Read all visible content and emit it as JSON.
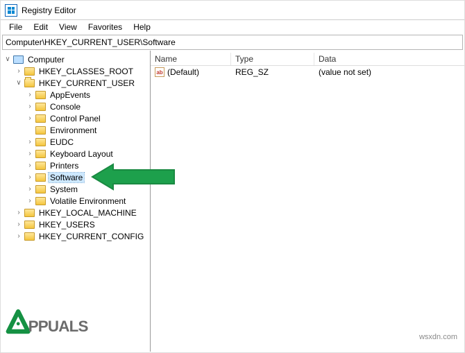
{
  "window": {
    "title": "Registry Editor"
  },
  "menu": {
    "file": "File",
    "edit": "Edit",
    "view": "View",
    "favorites": "Favorites",
    "help": "Help"
  },
  "address": "Computer\\HKEY_CURRENT_USER\\Software",
  "tree": {
    "root": "Computer",
    "hives": {
      "hkcr": "HKEY_CLASSES_ROOT",
      "hkcu": "HKEY_CURRENT_USER",
      "hklm": "HKEY_LOCAL_MACHINE",
      "hku": "HKEY_USERS",
      "hkcc": "HKEY_CURRENT_CONFIG"
    },
    "hkcu_children": {
      "appevents": "AppEvents",
      "console": "Console",
      "controlpanel": "Control Panel",
      "environment": "Environment",
      "eudc": "EUDC",
      "keyboardlayout": "Keyboard Layout",
      "printers": "Printers",
      "software": "Software",
      "system": "System",
      "volatile": "Volatile Environment"
    }
  },
  "list": {
    "columns": {
      "name": "Name",
      "type": "Type",
      "data": "Data"
    },
    "rows": [
      {
        "icon": "ab",
        "name": "(Default)",
        "type": "REG_SZ",
        "data": "(value not set)"
      }
    ]
  },
  "watermark": {
    "text": "PPUALS"
  },
  "credit": "wsxdn.com"
}
